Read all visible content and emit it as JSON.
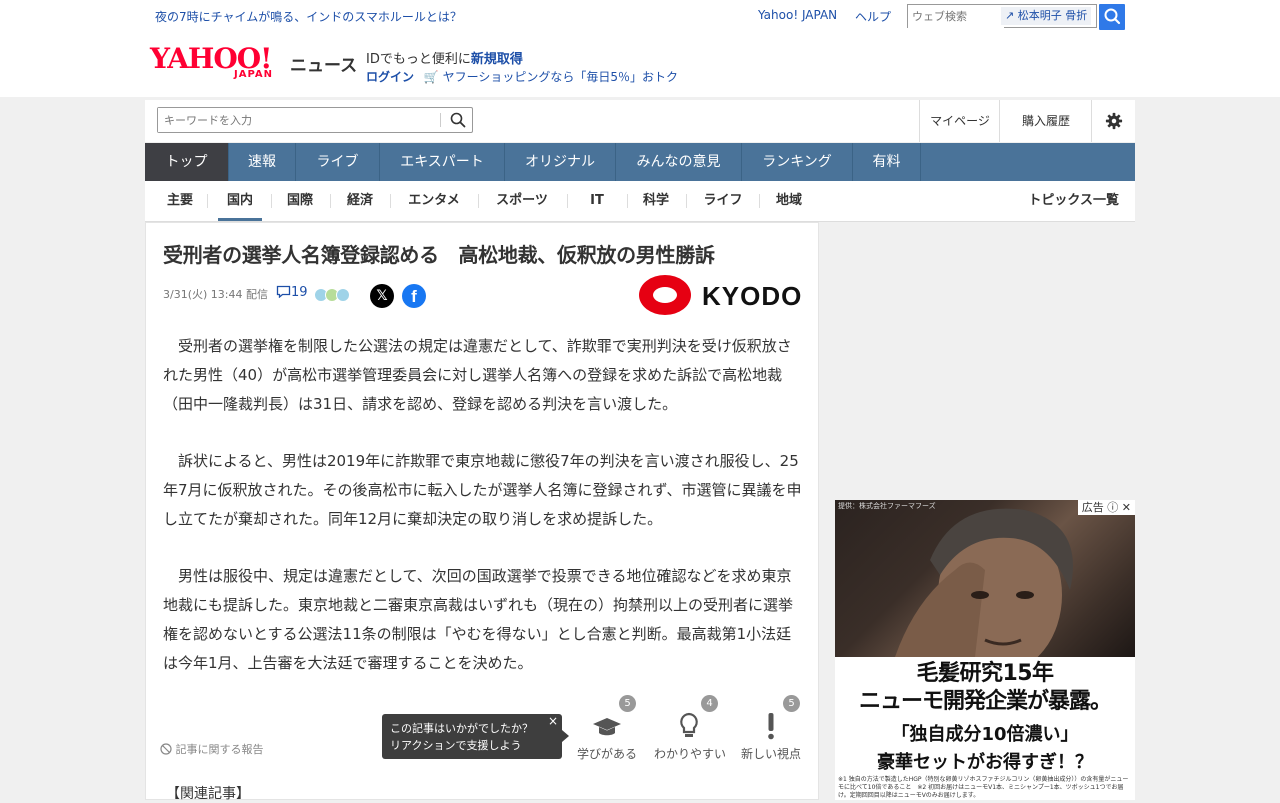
{
  "topbar": {
    "news_link": "夜の7時にチャイムが鳴る、インドのスマホルールとは？",
    "yahoo_japan": "Yahoo! JAPAN",
    "help": "ヘルプ",
    "web_search_placeholder": "ウェブ検索",
    "keyword_suggest": "松本明子 骨折"
  },
  "header": {
    "logo_text": "YAHOO!",
    "logo_sub": "JAPAN",
    "service": "ニュース",
    "id_text": "IDでもっと便利に",
    "id_new": "新規取得",
    "login": "ログイン",
    "shopping": "ヤフーショッピングなら「毎日5％」おトク"
  },
  "search": {
    "placeholder": "キーワードを入力",
    "mypage": "マイページ",
    "history": "購入履歴"
  },
  "nav": {
    "items": [
      "トップ",
      "速報",
      "ライブ",
      "エキスパート",
      "オリジナル",
      "みんなの意見",
      "ランキング",
      "有料"
    ]
  },
  "subnav": {
    "items": [
      "主要",
      "国内",
      "国際",
      "経済",
      "エンタメ",
      "スポーツ",
      "IT",
      "科学",
      "ライフ",
      "地域"
    ],
    "topics": "トピックス一覧"
  },
  "article": {
    "title": "受刑者の選挙人名簿登録認める　高松地裁、仮釈放の男性勝訴",
    "date": "3/31(火) 13:44",
    "delivered": "配信",
    "comment_count": "19",
    "source": "KYODO",
    "paragraphs": [
      "　受刑者の選挙権を制限した公選法の規定は違憲だとして、詐欺罪で実刑判決を受け仮釈放された男性（40）が高松市選挙管理委員会に対し選挙人名簿への登録を求めた訴訟で高松地裁（田中一隆裁判長）は31日、請求を認め、登録を認める判決を言い渡した。",
      "　訴状によると、男性は2019年に詐欺罪で東京地裁に懲役7年の判決を言い渡され服役し、25年7月に仮釈放された。その後高松市に転入したが選挙人名簿に登録されず、市選管に異議を申し立てたが棄却された。同年12月に棄却決定の取り消しを求め提訴した。",
      "　男性は服役中、規定は違憲だとして、次回の国政選挙で投票できる地位確認などを求め東京地裁にも提訴した。東京地裁と二審東京高裁はいずれも（現在の）拘禁刑以上の受刑者に選挙権を認めないとする公選法11条の制限は「やむを得ない」とし合憲と判断。最高裁第1小法廷は今年1月、上告審を大法廷で審理することを決めた。"
    ],
    "report": "記事に関する報告",
    "tooltip_line1": "この記事はいかがでしたか？",
    "tooltip_line2": "リアクションで支援しよう",
    "reactions": [
      {
        "label": "学びがある",
        "count": "5"
      },
      {
        "label": "わかりやすい",
        "count": "4"
      },
      {
        "label": "新しい視点",
        "count": "5"
      }
    ],
    "related": "【関連記事】"
  },
  "ad": {
    "label": "広告",
    "credit": "提供：株式会社ファーマフーズ",
    "line1": "毛髪研究15年",
    "line2": "ニューモ開発企業が暴露。",
    "line3": "「独自成分10倍濃い」",
    "line4": "豪華セットがお得すぎ！？",
    "fine": "※1 独自の方法で製造したHGP（特別な卵黄リゾホスファチジルコリン（卵黄抽出成分））の含有量がニューモに比べて10倍であること　※2 初回お届けはニューモV1本、ミニシャンプー1本、ツボッシュ1つでお届け。定期回回目以降はニューモVのみお届けします。"
  }
}
